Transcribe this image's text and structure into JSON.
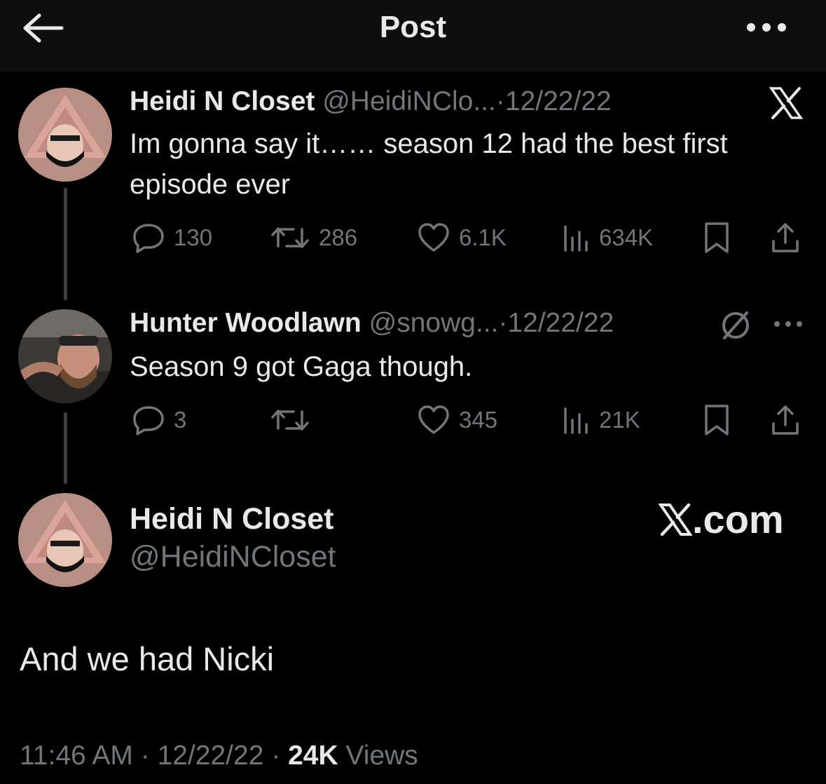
{
  "header": {
    "title": "Post",
    "back_icon": "arrow-left-icon",
    "more_icon": "more-horizontal-icon"
  },
  "thread": [
    {
      "name": "Heidi N Closet",
      "handle": "@HeidiNClo...",
      "separator": "·",
      "date": "12/22/22",
      "badge_icon": "x-logo-icon",
      "text": "Im gonna say it…… season 12 had the best first episode ever",
      "replies": "130",
      "reposts": "286",
      "likes": "6.1K",
      "views": "634K"
    },
    {
      "name": "Hunter Woodlawn",
      "handle": "@snowg...",
      "separator": "·",
      "date": "12/22/22",
      "badge_icon": "no-entry-icon",
      "text": "Season 9 got Gaga though.",
      "replies": "3",
      "reposts": "",
      "likes": "345",
      "views": "21K"
    }
  ],
  "main_post": {
    "name": "Heidi N Closet",
    "handle": "@HeidiNCloset",
    "brand": ".com",
    "text": "And we had Nicki",
    "time": "11:46 AM",
    "sep1": "·",
    "date": "12/22/22",
    "sep2": "·",
    "views_count": "24K",
    "views_label": "Views"
  },
  "colors": {
    "background": "#000000",
    "header": "#0e0e0e",
    "primary_text": "#e7e9ea",
    "secondary_text": "#71767b",
    "thread_line": "#3a3d40"
  }
}
